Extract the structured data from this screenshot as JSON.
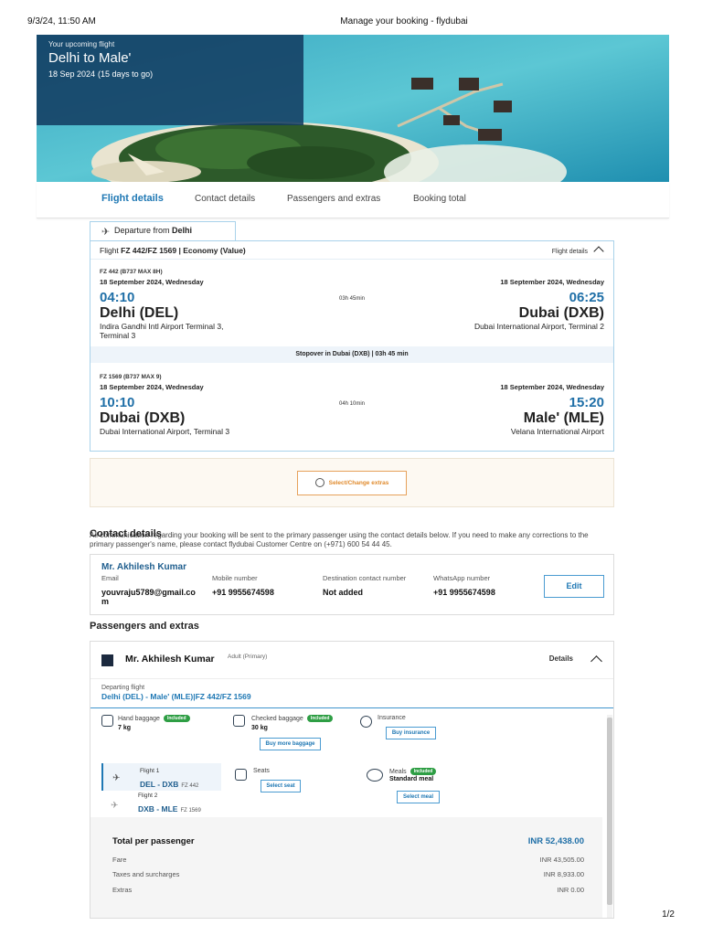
{
  "print": {
    "datetime": "9/3/24, 11:50 AM",
    "title": "Manage your booking - flydubai",
    "page": "1/2"
  },
  "hero": {
    "eyebrow": "Your upcoming flight",
    "route": "Delhi to Male'",
    "date": "18 Sep 2024",
    "countdown": "(15 days to go)"
  },
  "tabs": [
    {
      "label": "Flight details",
      "active": true
    },
    {
      "label": "Contact details",
      "active": false
    },
    {
      "label": "Passengers and extras",
      "active": false
    },
    {
      "label": "Booking total",
      "active": false
    }
  ],
  "departure": {
    "chip_prefix": "Departure from",
    "chip_city": "Delhi",
    "flight_prefix": "Flight",
    "flight_numbers": "FZ 442/FZ 1569",
    "cabin": "Economy (Value)",
    "toggle_label": "Flight details",
    "segments": [
      {
        "flight_no": "FZ 442 (B737 MAX 8H)",
        "dep_date": "18 September 2024, Wednesday",
        "arr_date": "18 September 2024, Wednesday",
        "dep_time": "04:10",
        "arr_time": "06:25",
        "duration": "03h 45min",
        "dep_city": "Delhi (DEL)",
        "arr_city": "Dubai (DXB)",
        "dep_airport": "Indira Gandhi Intl Airport Terminal 3, Terminal 3",
        "arr_airport": "Dubai International Airport, Terminal 2"
      },
      {
        "flight_no": "FZ 1569 (B737 MAX 9)",
        "dep_date": "18 September 2024, Wednesday",
        "arr_date": "18 September 2024, Wednesday",
        "dep_time": "10:10",
        "arr_time": "15:20",
        "duration": "04h 10min",
        "dep_city": "Dubai (DXB)",
        "arr_city": "Male' (MLE)",
        "dep_airport": "Dubai International Airport, Terminal 3",
        "arr_airport": "Velana International Airport"
      }
    ],
    "stopover": "Stopover in Dubai (DXB) | 03h 45 min"
  },
  "extras_button": "Select/Change extras",
  "contact": {
    "section_title": "Contact details",
    "note": "All communication regarding your booking will be sent to the primary passenger using the contact details below. If you need to make any corrections to the primary passenger's name, please contact flydubai Customer Centre on (+971) 600 54 44 45.",
    "name": "Mr. Akhilesh Kumar",
    "fields": [
      {
        "label": "Email",
        "value": "youvraju5789@gmail.com"
      },
      {
        "label": "Mobile number",
        "value": "+91 9955674598"
      },
      {
        "label": "Destination contact number",
        "value": "Not added"
      },
      {
        "label": "WhatsApp number",
        "value": "+91 9955674598"
      }
    ],
    "edit_label": "Edit"
  },
  "passengers": {
    "section_title": "Passengers and extras",
    "name": "Mr. Akhilesh Kumar",
    "type": "Adult (Primary)",
    "details_label": "Details",
    "departing_label": "Departing flight",
    "departing_route": "Delhi (DEL) - Male' (MLE)|FZ 442/FZ 1569",
    "hand_baggage": {
      "label": "Hand baggage",
      "badge": "Included",
      "value": "7 kg"
    },
    "checked_baggage": {
      "label": "Checked baggage",
      "badge": "Included",
      "value": "30 kg",
      "button": "Buy more baggage"
    },
    "insurance": {
      "label": "Insurance",
      "button": "Buy insurance"
    },
    "seats": {
      "label": "Seats",
      "button": "Select seat"
    },
    "meals": {
      "label": "Meals",
      "badge": "Included",
      "value": "Standard meal",
      "button": "Select meal"
    },
    "flights": [
      {
        "label": "Flight 1",
        "route": "DEL - DXB",
        "code": "FZ 442",
        "selected": true
      },
      {
        "label": "Flight 2",
        "route": "DXB - MLE",
        "code": "FZ 1569",
        "selected": false
      }
    ],
    "totals": {
      "label": "Total per passenger",
      "value": "INR 52,438.00",
      "rows": [
        {
          "label": "Fare",
          "value": "INR 43,505.00"
        },
        {
          "label": "Taxes and surcharges",
          "value": "INR 8,933.00"
        },
        {
          "label": "Extras",
          "value": "INR 0.00"
        }
      ]
    }
  },
  "colors": {
    "brand_blue": "#1f78b4",
    "hero_panel": "#123a60",
    "included_badge": "#2e9e44",
    "extras_accent": "#e08a2c"
  }
}
